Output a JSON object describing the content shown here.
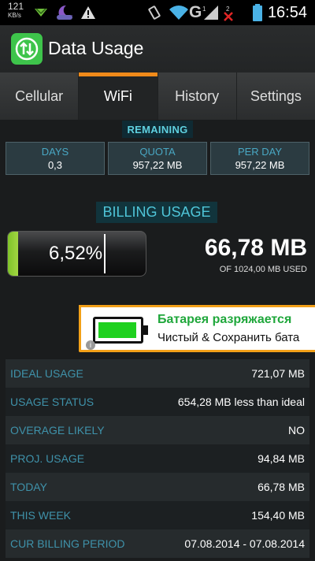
{
  "status_bar": {
    "speed_value": "121",
    "speed_unit": "KB/s",
    "network_letter": "G",
    "time": "16:54"
  },
  "app": {
    "title": "Data Usage"
  },
  "tabs": [
    {
      "label": "Cellular",
      "active": false
    },
    {
      "label": "WiFi",
      "active": true
    },
    {
      "label": "History",
      "active": false
    },
    {
      "label": "Settings",
      "active": false
    }
  ],
  "remaining": {
    "label": "REMAINING",
    "stats": [
      {
        "label": "DAYS",
        "value": "0,3"
      },
      {
        "label": "QUOTA",
        "value": "957,22 MB"
      },
      {
        "label": "PER DAY",
        "value": "957,22 MB"
      }
    ]
  },
  "billing": {
    "label": "BILLING USAGE",
    "percent_text": "6,52%",
    "percent_fill": 0.0652,
    "used": "66,78 MB",
    "of_total": "OF 1024,00 MB USED"
  },
  "ad": {
    "title": "Батарея разряжается",
    "text": "Чистый & Сохранить бата",
    "info_glyph": "i"
  },
  "details": [
    {
      "key": "IDEAL USAGE",
      "value": "721,07 MB"
    },
    {
      "key": "USAGE STATUS",
      "value": "654,28 MB less than ideal"
    },
    {
      "key": "OVERAGE LIKELY",
      "value": "NO"
    },
    {
      "key": "PROJ. USAGE",
      "value": "94,84 MB"
    },
    {
      "key": "TODAY",
      "value": "66,78 MB"
    },
    {
      "key": "THIS WEEK",
      "value": "154,40 MB"
    },
    {
      "key": "CUR BILLING PERIOD",
      "value": "07.08.2014 - 07.08.2014"
    }
  ],
  "colors": {
    "accent_orange": "#f08a1a",
    "label_blue": "#3f92aa",
    "battery_green": "#7fc32a",
    "app_icon_green": "#3ec44b"
  }
}
